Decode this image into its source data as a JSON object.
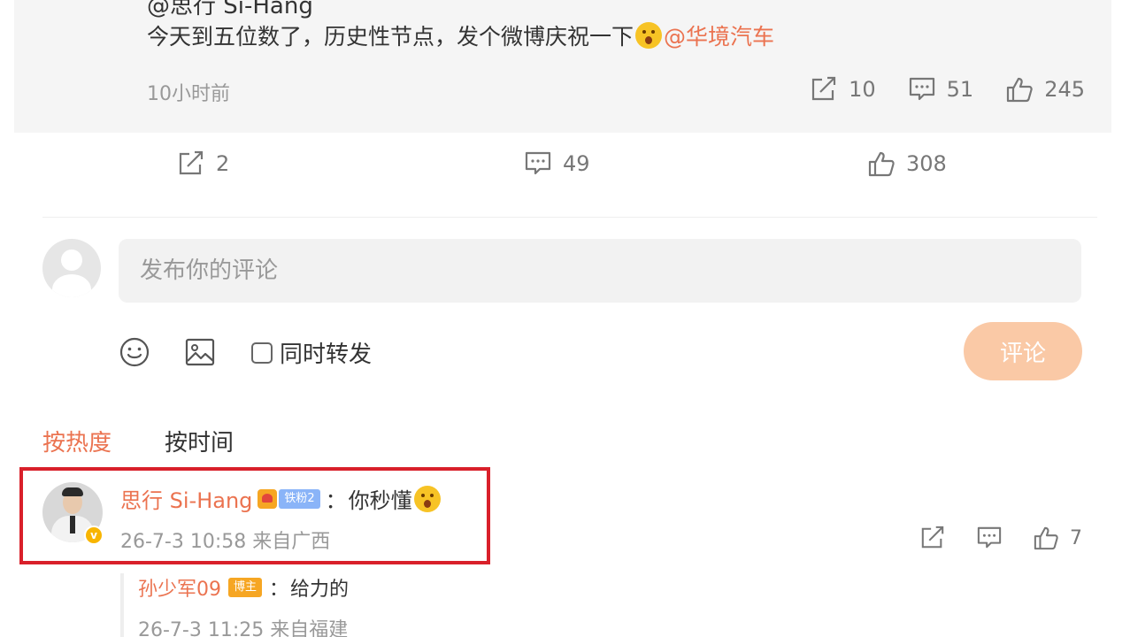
{
  "quoted_post": {
    "cut_off_header": "@思行 Si-Hang",
    "text": "今天到五位数了，历史性节点，发个微博庆祝一下",
    "mention": "@华境汽车",
    "time": "10小时前",
    "reposts": "10",
    "comments": "51",
    "likes": "245"
  },
  "post_actions": {
    "reposts": "2",
    "comments": "49",
    "likes": "308"
  },
  "composer": {
    "placeholder": "发布你的评论",
    "repost_label": "同时转发",
    "submit_label": "评论"
  },
  "sort": {
    "hot_label": "按热度",
    "time_label": "按时间"
  },
  "comment": {
    "author": "思行 Si-Hang",
    "fan_badge": "铁粉2",
    "colon": "：",
    "text": "你秒懂",
    "meta": "26-7-3 10:58 来自广西",
    "likes": "7",
    "verified_mark": "v"
  },
  "reply": {
    "author": "孙少军09",
    "badge": "博主",
    "colon": "：",
    "text": "给力的",
    "meta": "26-7-3 11:25 来自福建"
  },
  "colors": {
    "accent": "#eb7350",
    "highlight_box": "#d9202a",
    "submit_disabled": "#fac9a6",
    "quote_background": "#f5f5f5"
  }
}
